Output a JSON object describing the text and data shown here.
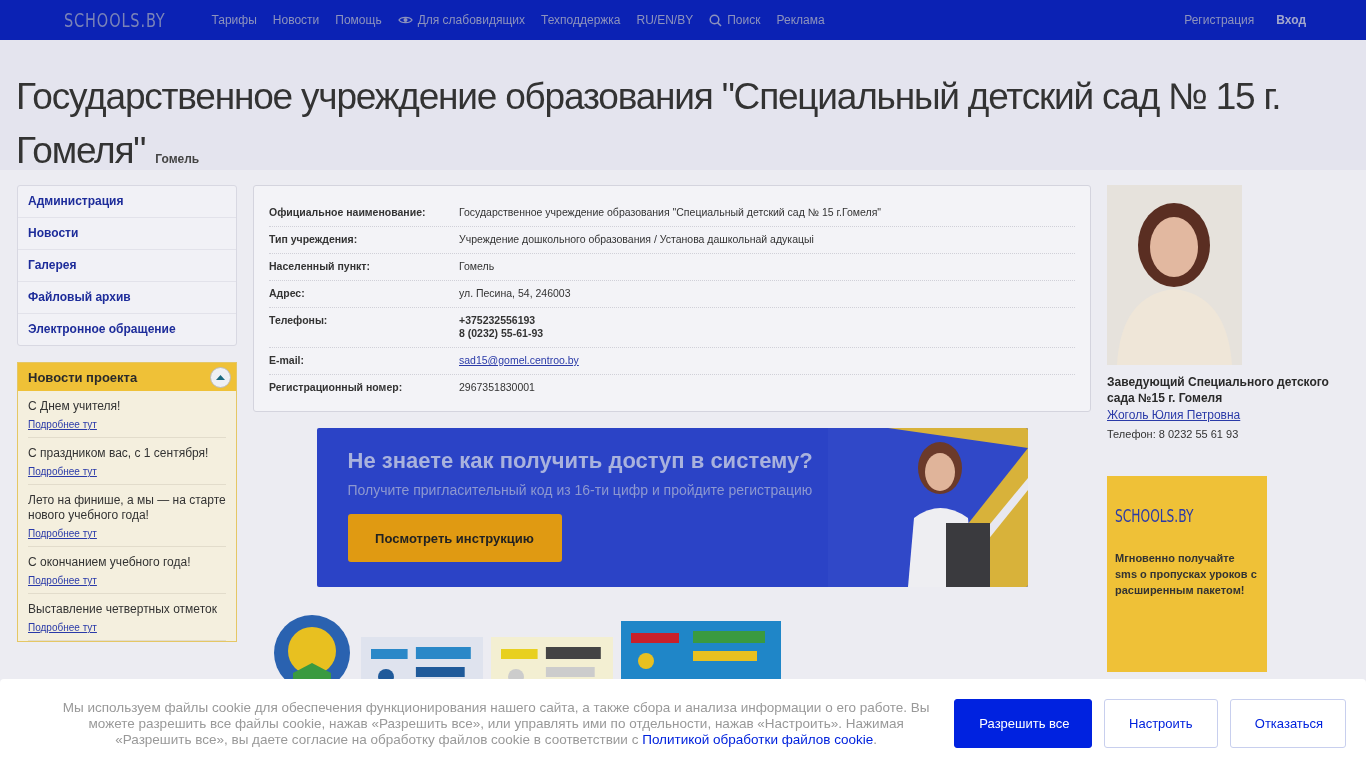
{
  "header": {
    "logo": "SCHOOLS.BY",
    "nav": [
      {
        "label": "Тарифы",
        "kind": "link"
      },
      {
        "label": "Новости",
        "kind": "link"
      },
      {
        "label": "Помощь",
        "kind": "link"
      },
      {
        "label": "Для слабовидящих",
        "kind": "accessibility"
      },
      {
        "label": "Техподдержка",
        "kind": "link"
      },
      {
        "label": "RU/EN/BY",
        "kind": "link"
      },
      {
        "label": "Поиск",
        "kind": "search"
      },
      {
        "label": "Реклама",
        "kind": "link"
      }
    ],
    "account": [
      {
        "label": "Регистрация",
        "bold": false
      },
      {
        "label": "Вход",
        "bold": true
      }
    ]
  },
  "title": {
    "text": "Государственное учреждение образования \"Специальный детский сад № 15 г. Гомеля\"",
    "city": "Гомель"
  },
  "sidebar": {
    "menu": [
      "Администрация",
      "Новости",
      "Галерея",
      "Файловый архив",
      "Электронное обращение"
    ],
    "news": {
      "title": "Новости проекта",
      "expanded": true,
      "items": [
        {
          "text": "С Днем учителя!",
          "link": "Подробнее тут"
        },
        {
          "text": "С праздником вас, с 1 сентября!",
          "link": "Подробнее тут"
        },
        {
          "text": "Лето на финише, а мы — на старте нового учебного года!",
          "link": "Подробнее тут"
        },
        {
          "text": "С окончанием учебного года!",
          "link": "Подробнее тут"
        },
        {
          "text": "Выставление четвертных отметок",
          "link": "Подробнее тут"
        }
      ]
    }
  },
  "info": [
    {
      "label": "Официальное наименование:",
      "kind": "text",
      "values": [
        "Государственное учреждение образования \"Специальный детский сад № 15 г.Гомеля\""
      ]
    },
    {
      "label": "Тип учреждения:",
      "kind": "text",
      "values": [
        "Учреждение дошкольного образования / Установа дашкольнай адукацыі"
      ]
    },
    {
      "label": "Населенный пункт:",
      "kind": "text",
      "values": [
        "Гомель"
      ]
    },
    {
      "label": "Адрес:",
      "kind": "text",
      "values": [
        "ул. Песина, 54, 246003"
      ]
    },
    {
      "label": "Телефоны:",
      "kind": "bold",
      "values": [
        "+375232556193",
        "8 (0232) 55-61-93"
      ]
    },
    {
      "label": "E-mail:",
      "kind": "link",
      "values": [
        "sad15@gomel.centroo.by"
      ]
    },
    {
      "label": "Регистрационный номер:",
      "kind": "text",
      "values": [
        "2967351830001"
      ]
    }
  ],
  "banner": {
    "heading": "Не знаете как получить доступ в систему?",
    "subheading": "Получите пригласительный код из 16-ти цифр и пройдите регистрацию",
    "button": "Посмотреть инструкцию"
  },
  "head": {
    "position": "Заведующий Специального детского сада №15 г. Гомеля",
    "name": "Жоголь Юлия Петровна",
    "phone": "Телефон: 8 0232 55 61 93"
  },
  "ad": {
    "logo": "SCHOOLS.BY",
    "text": "Мгновенно получайте sms о пропусках уроков с расширенным пакетом!"
  },
  "cookie": {
    "text": "Мы используем файлы cookie для обеспечения функционирования нашего сайта, а также сбора и анализа информации о его работе. Вы можете разрешить все файлы cookie, нажав «Разрешить все», или управлять ими по отдельности, нажав «Настроить». Нажимая «Разрешить все», вы даете согласие на обработку файлов cookie в соответствии с",
    "link": "Политикой обработки файлов cookie",
    "end": ".",
    "buttons": [
      {
        "label": "Разрешить все",
        "primary": true
      },
      {
        "label": "Настроить",
        "primary": false
      },
      {
        "label": "Отказаться",
        "primary": false
      }
    ]
  }
}
